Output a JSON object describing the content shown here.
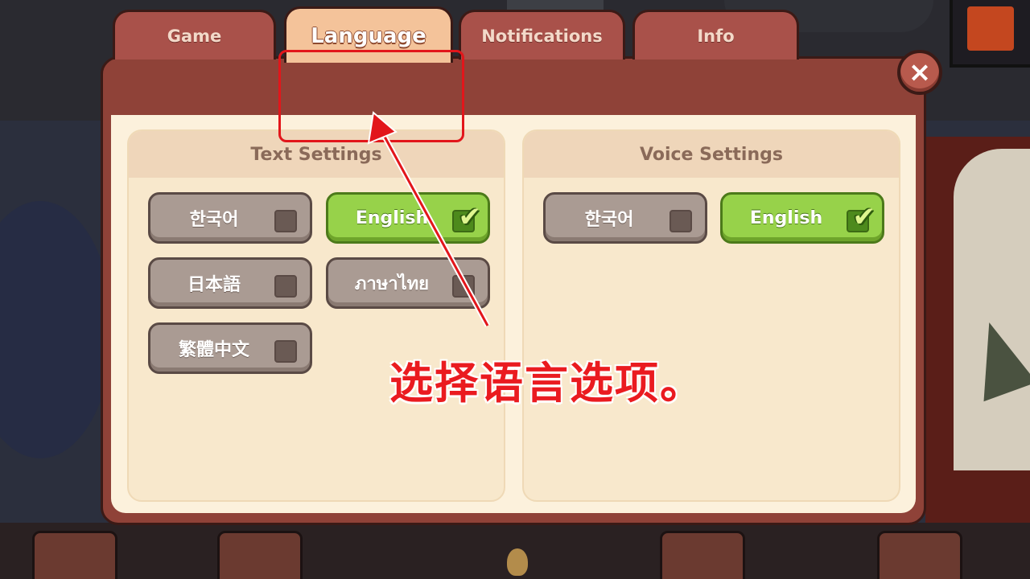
{
  "tabs": [
    {
      "label": "Game"
    },
    {
      "label": "Language"
    },
    {
      "label": "Notifications"
    },
    {
      "label": "Info"
    }
  ],
  "active_tab": "Language",
  "close_icon": "×",
  "text_settings": {
    "title": "Text Settings",
    "options": [
      {
        "label": "한국어",
        "selected": false
      },
      {
        "label": "English",
        "selected": true
      },
      {
        "label": "日本語",
        "selected": false
      },
      {
        "label": "ภาษาไทย",
        "selected": false
      },
      {
        "label": "繁體中文",
        "selected": false
      }
    ]
  },
  "voice_settings": {
    "title": "Voice Settings",
    "options": [
      {
        "label": "한국어",
        "selected": false
      },
      {
        "label": "English",
        "selected": true
      }
    ]
  },
  "annotation": {
    "caption": "选择语言选项。",
    "color": "#e2161b"
  },
  "check_icon": "✔"
}
